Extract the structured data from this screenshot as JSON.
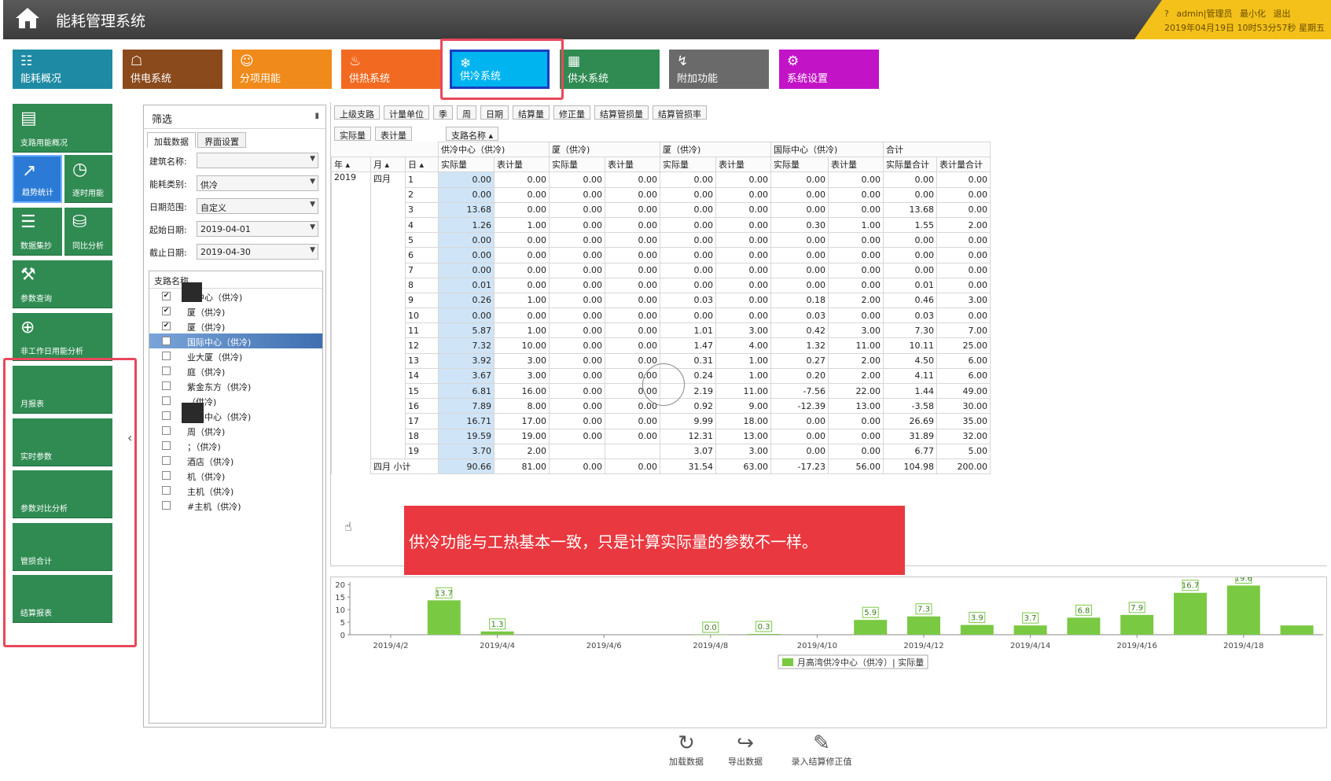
{
  "app": {
    "title": "能耗管理系统"
  },
  "user_bar": {
    "help": "?",
    "user": "admin|管理员",
    "minimize": "最小化",
    "exit": "退出",
    "datetime": "2019年04月19日 10时53分57秒 星期五"
  },
  "modules": [
    {
      "label": "能耗概况",
      "icon": "☷",
      "color": "#1e8aa3"
    },
    {
      "label": "供电系统",
      "icon": "☖",
      "color": "#8a4a1c"
    },
    {
      "label": "分项用能",
      "icon": "☺",
      "color": "#f08a1a"
    },
    {
      "label": "供热系统",
      "icon": "♨",
      "color": "#f26a21"
    },
    {
      "label": "供冷系统",
      "icon": "❄",
      "color": "#00b4ef"
    },
    {
      "label": "供水系统",
      "icon": "▦",
      "color": "#2f8b52"
    },
    {
      "label": "附加功能",
      "icon": "↯",
      "color": "#6a6a6a"
    },
    {
      "label": "系统设置",
      "icon": "⚙",
      "color": "#c214c6"
    }
  ],
  "left_nav": [
    {
      "label": "支路用能概况",
      "icon": "▤"
    },
    {
      "label": "趋势统计",
      "icon": "↗"
    },
    {
      "label": "逐时用能",
      "icon": "◷"
    },
    {
      "label": "数据集抄",
      "icon": "☰"
    },
    {
      "label": "同比分析",
      "icon": "⛁"
    },
    {
      "label": "参数查询",
      "icon": "⚒"
    },
    {
      "label": "非工作日用能分析",
      "icon": "⊕"
    },
    {
      "label": "月报表",
      "icon": ""
    },
    {
      "label": "实时参数",
      "icon": ""
    },
    {
      "label": "参数对比分析",
      "icon": ""
    },
    {
      "label": "管损合计",
      "icon": ""
    },
    {
      "label": "结算报表",
      "icon": ""
    }
  ],
  "filter": {
    "title": "筛选",
    "pin": "▮",
    "tabs": [
      "加载数据",
      "界面设置"
    ],
    "building_label": "建筑名称:",
    "building_value": "",
    "energy_label": "能耗类别:",
    "energy_value": "供冷",
    "range_label": "日期范围:",
    "range_value": "自定义",
    "start_label": "起始日期:",
    "start_value": "2019-04-01",
    "end_label": "截止日期:",
    "end_value": "2019-04-30",
    "tree_header": "支路名称",
    "tree_items": [
      {
        "label": "冷中心（供冷)",
        "checked": true
      },
      {
        "label": "厦（供冷)",
        "checked": true
      },
      {
        "label": "厦（供冷)",
        "checked": true
      },
      {
        "label": "国际中心（供冷)",
        "checked": true
      },
      {
        "label": "业大厦（供冷)",
        "checked": false
      },
      {
        "label": "庭（供冷)",
        "checked": false
      },
      {
        "label": "紫金东方（供冷)",
        "checked": false
      },
      {
        "label": "（供冷)",
        "checked": false
      },
      {
        "label": "数据中心（供冷)",
        "checked": false
      },
      {
        "label": "周（供冷)",
        "checked": false
      },
      {
        "label": "；（供冷)",
        "checked": false
      },
      {
        "label": "酒店（供冷)",
        "checked": false
      },
      {
        "label": "机（供冷)",
        "checked": false
      },
      {
        "label": "主机（供冷)",
        "checked": false
      },
      {
        "label": "#主机（供冷)",
        "checked": false
      }
    ]
  },
  "fieldbar_top": [
    "上级支路",
    "计量单位",
    "季",
    "周",
    "日期",
    "结算量",
    "修正量",
    "结算管损量",
    "结算管损率"
  ],
  "fieldbar_data": [
    "实际量",
    "表计量"
  ],
  "column_field": "支路名称 ▴",
  "grid": {
    "row_fields": [
      "年 ▴",
      "月 ▴",
      "日 ▴"
    ],
    "groups": [
      "供冷中心（供冷)",
      "厦（供冷)",
      "厦（供冷)",
      "国际中心（供冷)",
      "合计"
    ],
    "subheaders": [
      "实际量",
      "表计量",
      "实际量",
      "表计量",
      "实际量",
      "表计量",
      "实际量",
      "表计量",
      "实际量合计",
      "表计量合计"
    ],
    "year": "2019",
    "month": "四月",
    "rows": [
      [
        "1",
        "0.00",
        "0.00",
        "0.00",
        "0.00",
        "0.00",
        "0.00",
        "0.00",
        "0.00",
        "0.00",
        "0.00"
      ],
      [
        "2",
        "0.00",
        "0.00",
        "0.00",
        "0.00",
        "0.00",
        "0.00",
        "0.00",
        "0.00",
        "0.00",
        "0.00"
      ],
      [
        "3",
        "13.68",
        "0.00",
        "0.00",
        "0.00",
        "0.00",
        "0.00",
        "0.00",
        "0.00",
        "13.68",
        "0.00"
      ],
      [
        "4",
        "1.26",
        "1.00",
        "0.00",
        "0.00",
        "0.00",
        "0.00",
        "0.30",
        "1.00",
        "1.55",
        "2.00"
      ],
      [
        "5",
        "0.00",
        "0.00",
        "0.00",
        "0.00",
        "0.00",
        "0.00",
        "0.00",
        "0.00",
        "0.00",
        "0.00"
      ],
      [
        "6",
        "0.00",
        "0.00",
        "0.00",
        "0.00",
        "0.00",
        "0.00",
        "0.00",
        "0.00",
        "0.00",
        "0.00"
      ],
      [
        "7",
        "0.00",
        "0.00",
        "0.00",
        "0.00",
        "0.00",
        "0.00",
        "0.00",
        "0.00",
        "0.00",
        "0.00"
      ],
      [
        "8",
        "0.01",
        "0.00",
        "0.00",
        "0.00",
        "0.00",
        "0.00",
        "0.00",
        "0.00",
        "0.01",
        "0.00"
      ],
      [
        "9",
        "0.26",
        "1.00",
        "0.00",
        "0.00",
        "0.03",
        "0.00",
        "0.18",
        "2.00",
        "0.46",
        "3.00"
      ],
      [
        "10",
        "0.00",
        "0.00",
        "0.00",
        "0.00",
        "0.00",
        "0.00",
        "0.03",
        "0.00",
        "0.03",
        "0.00"
      ],
      [
        "11",
        "5.87",
        "1.00",
        "0.00",
        "0.00",
        "1.01",
        "3.00",
        "0.42",
        "3.00",
        "7.30",
        "7.00"
      ],
      [
        "12",
        "7.32",
        "10.00",
        "0.00",
        "0.00",
        "1.47",
        "4.00",
        "1.32",
        "11.00",
        "10.11",
        "25.00"
      ],
      [
        "13",
        "3.92",
        "3.00",
        "0.00",
        "0.00",
        "0.31",
        "1.00",
        "0.27",
        "2.00",
        "4.50",
        "6.00"
      ],
      [
        "14",
        "3.67",
        "3.00",
        "0.00",
        "0.00",
        "0.24",
        "1.00",
        "0.20",
        "2.00",
        "4.11",
        "6.00"
      ],
      [
        "15",
        "6.81",
        "16.00",
        "0.00",
        "0.00",
        "2.19",
        "11.00",
        "-7.56",
        "22.00",
        "1.44",
        "49.00"
      ],
      [
        "16",
        "7.89",
        "8.00",
        "0.00",
        "0.00",
        "0.92",
        "9.00",
        "-12.39",
        "13.00",
        "-3.58",
        "30.00"
      ],
      [
        "17",
        "16.71",
        "17.00",
        "0.00",
        "0.00",
        "9.99",
        "18.00",
        "0.00",
        "0.00",
        "26.69",
        "35.00"
      ],
      [
        "18",
        "19.59",
        "19.00",
        "0.00",
        "0.00",
        "12.31",
        "13.00",
        "0.00",
        "0.00",
        "31.89",
        "32.00"
      ],
      [
        "19",
        "3.70",
        "2.00",
        "",
        "",
        "3.07",
        "3.00",
        "0.00",
        "0.00",
        "6.77",
        "5.00"
      ]
    ],
    "subtotal_label": "四月 小计",
    "subtotal": [
      "90.66",
      "81.00",
      "0.00",
      "0.00",
      "31.54",
      "63.00",
      "-17.23",
      "56.00",
      "104.98",
      "200.00"
    ]
  },
  "callout": "供冷功能与工热基本一致，只是计算实际量的参数不一样。",
  "chart_data": {
    "type": "bar",
    "categories": [
      "2019/4/1",
      "2019/4/2",
      "2019/4/3",
      "2019/4/4",
      "2019/4/5",
      "2019/4/6",
      "2019/4/7",
      "2019/4/8",
      "2019/4/9",
      "2019/4/10",
      "2019/4/11",
      "2019/4/12",
      "2019/4/13",
      "2019/4/14",
      "2019/4/15",
      "2019/4/16",
      "2019/4/17",
      "2019/4/18",
      "2019/4/19"
    ],
    "values": [
      0,
      0,
      13.7,
      1.3,
      0,
      0,
      0,
      0.0,
      0.3,
      0,
      5.9,
      7.3,
      3.9,
      3.7,
      6.8,
      7.9,
      16.7,
      19.6,
      3.7
    ],
    "labels": [
      "",
      "",
      "13.7",
      "1.3",
      "",
      "",
      "",
      "0.0",
      "0.3",
      "",
      "5.9",
      "7.3",
      "3.9",
      "3.7",
      "6.8",
      "7.9",
      "16.7",
      "19.6",
      ""
    ],
    "x_tick_labels": [
      "2019/4/2",
      "2019/4/4",
      "2019/4/6",
      "2019/4/8",
      "2019/4/10",
      "2019/4/12",
      "2019/4/14",
      "2019/4/16",
      "2019/4/18"
    ],
    "y_ticks": [
      0,
      5,
      10,
      15,
      20
    ],
    "ylim": [
      0,
      21
    ],
    "series_name": "月高湾供冷中心（供冷）| 实际量",
    "bar_color": "#7ac943",
    "legend_position": "bottom"
  },
  "bottom_toolbar": [
    {
      "label": "加载数据",
      "icon": "↻"
    },
    {
      "label": "导出数据",
      "icon": "↪"
    },
    {
      "label": "录入结算修正值",
      "icon": "✎"
    }
  ]
}
